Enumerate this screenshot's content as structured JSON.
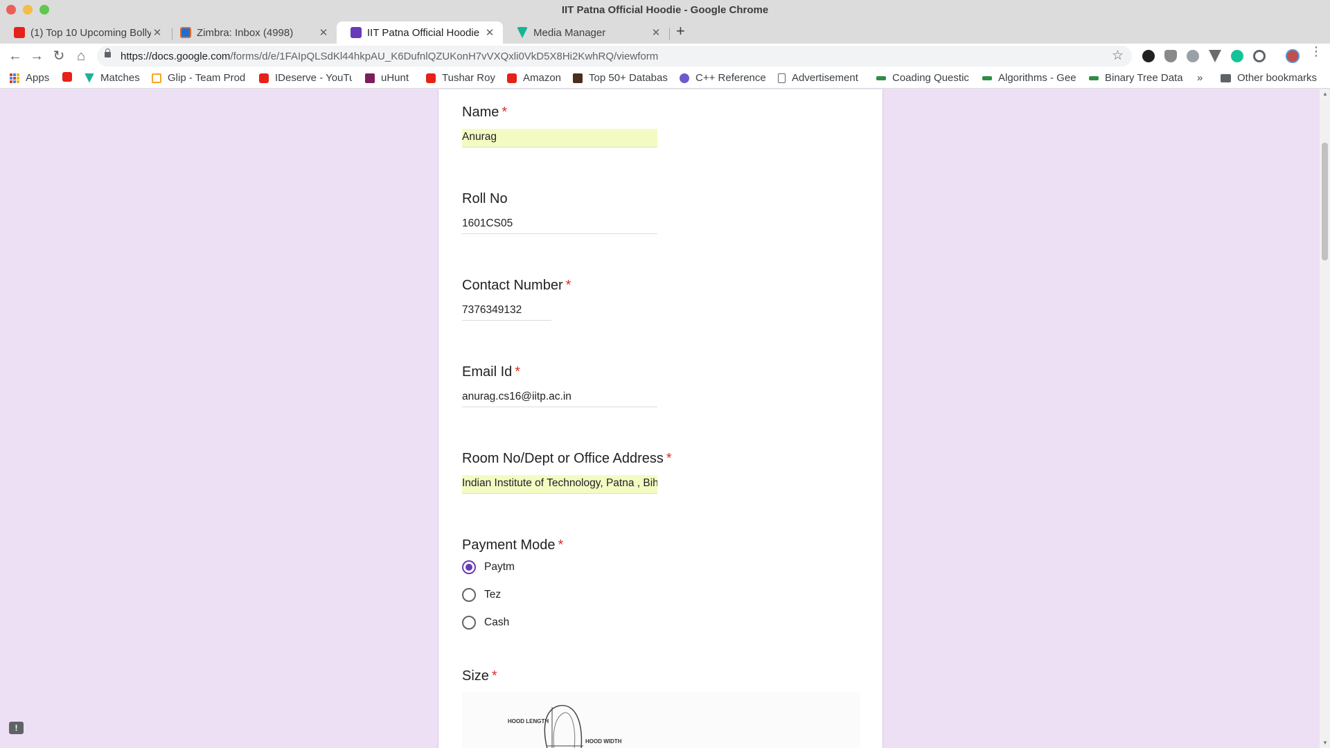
{
  "window": {
    "title": "IIT Patna Official Hoodie - Google Chrome"
  },
  "tabs": [
    {
      "label": "(1) Top 10 Upcoming Bolly",
      "icon": "youtube-icon"
    },
    {
      "label": "Zimbra: Inbox (4998)",
      "icon": "zimbra-icon"
    },
    {
      "label": "IIT Patna Official Hoodie",
      "icon": "google-forms-icon",
      "active": true
    },
    {
      "label": "Media Manager",
      "icon": "vuetify-icon"
    }
  ],
  "toolbar": {
    "url_host": "https://docs.google.com",
    "url_path": "/forms/d/e/1FAIpQLSdKl44hkpAU_K6DufnlQZUKonH7vVXQxli0VkD5X8Hi2KwhRQ/viewform"
  },
  "bookmarks": [
    {
      "label": "Apps",
      "icon": "apps-grid-icon"
    },
    {
      "label": "",
      "icon": "youtube-icon"
    },
    {
      "label": "Matches",
      "icon": "vuetify-icon"
    },
    {
      "label": "Glip - Team Prod",
      "icon": "glip-icon"
    },
    {
      "label": "IDeserve - YouTu",
      "icon": "youtube-icon"
    },
    {
      "label": "uHunt",
      "icon": "uhunt-icon"
    },
    {
      "label": "Tushar Roy",
      "icon": "youtube-icon"
    },
    {
      "label": "Amazon",
      "icon": "youtube-icon"
    },
    {
      "label": "Top 50+ Databas",
      "icon": "database-icon"
    },
    {
      "label": "C++ Reference",
      "icon": "cpp-icon"
    },
    {
      "label": "Advertisement",
      "icon": "page-icon"
    },
    {
      "label": "Coading Questic",
      "icon": "geeksforgeeks-icon"
    },
    {
      "label": "Algorithms - Gee",
      "icon": "geeksforgeeks-icon"
    },
    {
      "label": "Binary Tree Data",
      "icon": "geeksforgeeks-icon"
    },
    {
      "label": "»",
      "icon": ""
    },
    {
      "label": "Other bookmarks",
      "icon": "folder-icon"
    }
  ],
  "form": {
    "name": {
      "label": "Name",
      "required": "*",
      "value": "Anurag"
    },
    "roll": {
      "label": "Roll No",
      "value": "1601CS05"
    },
    "contact": {
      "label": "Contact Number",
      "required": "*",
      "value": "7376349132"
    },
    "email": {
      "label": "Email Id",
      "required": "*",
      "value": "anurag.cs16@iitp.ac.in"
    },
    "address": {
      "label": "Room No/Dept or Office Address",
      "required": "*",
      "value": "Indian Institute of Technology, Patna , Bihta"
    },
    "payment": {
      "label": "Payment Mode",
      "required": "*",
      "options": [
        "Paytm",
        "Tez",
        "Cash"
      ],
      "selected": "Paytm"
    },
    "size": {
      "label": "Size",
      "required": "*",
      "image_labels": [
        "HOOD LENGTH",
        "HOOD WIDTH"
      ]
    }
  },
  "colors": {
    "accent": "#673ab7",
    "required": "#d93025",
    "autofill": "#f4fbc2",
    "page_bg": "#ede0f5"
  },
  "feedback": {
    "label": "!"
  }
}
